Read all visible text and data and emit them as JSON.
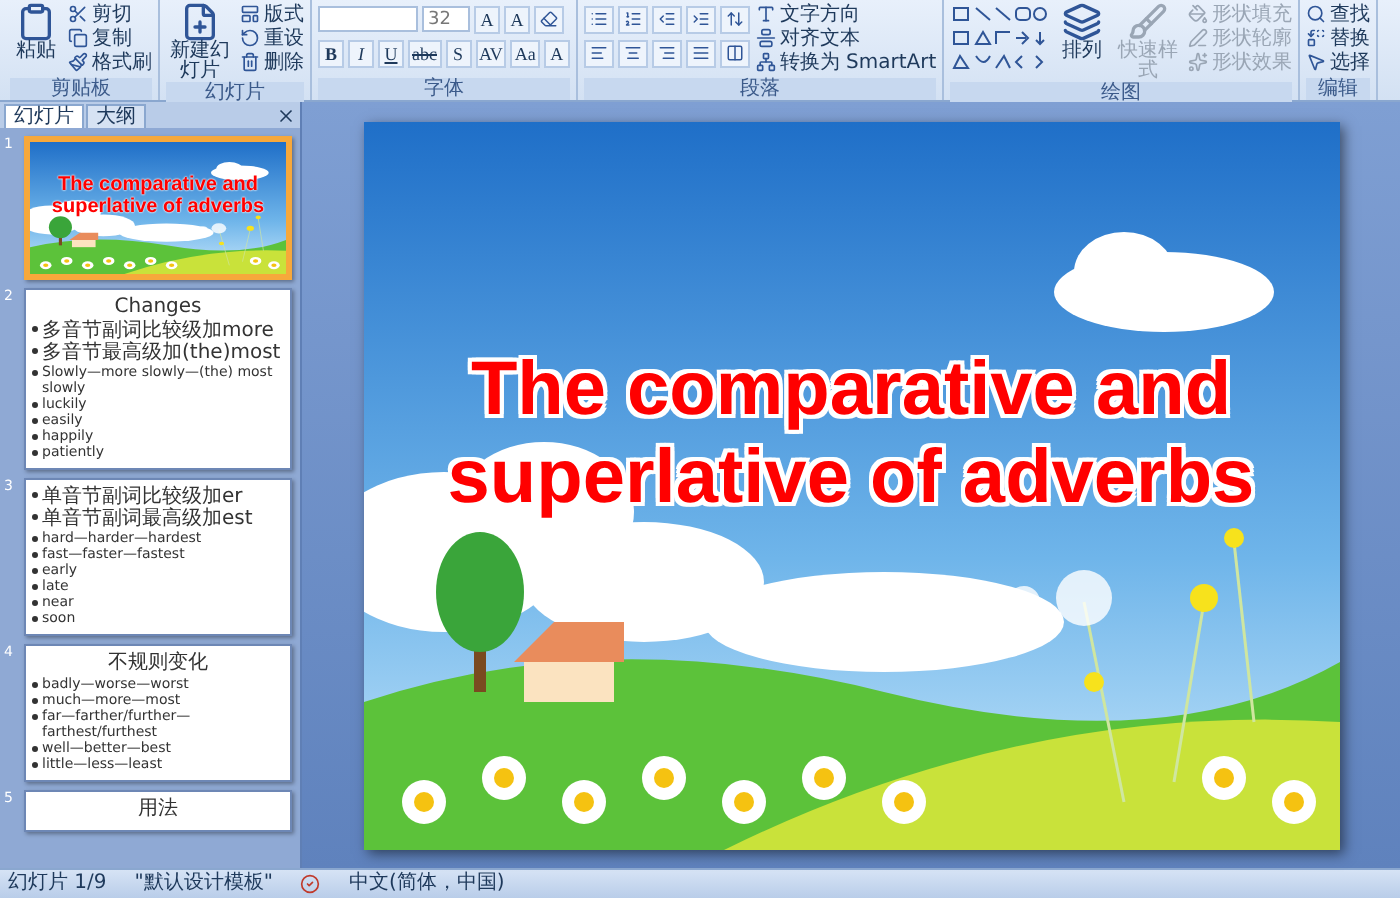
{
  "ribbon": {
    "groups": [
      {
        "label": "剪贴板",
        "parts": [
          {
            "kind": "large",
            "label": "粘贴",
            "disabled": false
          },
          {
            "kind": "column",
            "items": [
              {
                "kind": "small",
                "label": "剪切",
                "disabled": false
              },
              {
                "kind": "small",
                "label": "复制",
                "disabled": false
              },
              {
                "kind": "small",
                "label": "格式刷",
                "disabled": false
              }
            ]
          }
        ]
      },
      {
        "label": "幻灯片",
        "parts": [
          {
            "kind": "large",
            "label": "新建幻灯片",
            "disabled": false
          },
          {
            "kind": "column",
            "items": [
              {
                "kind": "small",
                "label": "版式",
                "disabled": false
              },
              {
                "kind": "small",
                "label": "重设",
                "disabled": false
              },
              {
                "kind": "small",
                "label": "删除",
                "disabled": false
              }
            ]
          }
        ]
      },
      {
        "label": "字体",
        "parts": [
          {
            "kind": "toolrows",
            "rows": [
              {
                "items": [
                  {
                    "kind": "field"
                  },
                  {
                    "kind": "field",
                    "value": "32"
                  },
                  {
                    "kind": "glyph",
                    "label": "A"
                  },
                  {
                    "kind": "glyph",
                    "label": "A"
                  },
                  {
                    "kind": "tool"
                  }
                ]
              },
              {
                "items": [
                  {
                    "kind": "glyph",
                    "label": "B"
                  },
                  {
                    "kind": "glyph",
                    "label": "I"
                  },
                  {
                    "kind": "glyph",
                    "label": "U"
                  },
                  {
                    "kind": "glyph",
                    "label": "abc"
                  },
                  {
                    "kind": "glyph",
                    "label": "S"
                  },
                  {
                    "kind": "glyph",
                    "label": "AV"
                  },
                  {
                    "kind": "glyph",
                    "label": "Aa"
                  },
                  {
                    "kind": "glyph",
                    "label": "A"
                  }
                ]
              }
            ]
          }
        ]
      },
      {
        "label": "段落",
        "parts": [
          {
            "kind": "toolrows",
            "rows": [
              {
                "items": [
                  {
                    "kind": "tool"
                  },
                  {
                    "kind": "tool"
                  },
                  {
                    "kind": "tool"
                  },
                  {
                    "kind": "tool"
                  },
                  {
                    "kind": "tool"
                  }
                ]
              },
              {
                "items": [
                  {
                    "kind": "tool"
                  },
                  {
                    "kind": "tool"
                  },
                  {
                    "kind": "tool"
                  },
                  {
                    "kind": "tool"
                  },
                  {
                    "kind": "tool"
                  }
                ]
              }
            ]
          },
          {
            "kind": "column",
            "items": [
              {
                "kind": "small",
                "label": "文字方向",
                "disabled": false
              },
              {
                "kind": "small",
                "label": "对齐文本",
                "disabled": false
              },
              {
                "kind": "small",
                "label": "转换为 SmartArt",
                "disabled": false
              }
            ]
          }
        ]
      },
      {
        "label": "绘图",
        "parts": [
          {
            "kind": "shapes"
          },
          {
            "kind": "large",
            "label": "排列",
            "disabled": false
          },
          {
            "kind": "large",
            "label": "快速样式",
            "disabled": true
          },
          {
            "kind": "column",
            "items": [
              {
                "kind": "small",
                "label": "形状填充",
                "disabled": true
              },
              {
                "kind": "small",
                "label": "形状轮廓",
                "disabled": true
              },
              {
                "kind": "small",
                "label": "形状效果",
                "disabled": true
              }
            ]
          }
        ]
      },
      {
        "label": "编辑",
        "parts": [
          {
            "kind": "column",
            "items": [
              {
                "kind": "small",
                "label": "查找",
                "disabled": false
              },
              {
                "kind": "small",
                "label": "替换",
                "disabled": false
              },
              {
                "kind": "small",
                "label": "选择",
                "disabled": false
              }
            ]
          }
        ]
      }
    ]
  },
  "panel": {
    "tabs": [
      {
        "label": "幻灯片",
        "selected": true
      },
      {
        "label": "大纲",
        "selected": false
      }
    ],
    "slides": [
      {
        "number": "1",
        "selected": true,
        "kind": "cover",
        "title": "The comparative and superlative of adverbs"
      },
      {
        "number": "2",
        "selected": false,
        "kind": "content",
        "title": "Changes",
        "bullets": [
          "多音节副词比较级加more",
          "多音节最高级加(the)most",
          "Slowly—more slowly—(the) most slowly",
          "luckily",
          "easily",
          "happily",
          "patiently"
        ]
      },
      {
        "number": "3",
        "selected": false,
        "kind": "content",
        "bullets": [
          "单音节副词比较级加er",
          "单音节副词最高级加est",
          "hard—harder—hardest",
          "fast—faster—fastest",
          "early",
          "late",
          "near",
          "soon"
        ]
      },
      {
        "number": "4",
        "selected": false,
        "kind": "content",
        "title": "不规则变化",
        "bullets": [
          "badly—worse—worst",
          "much—more—most",
          "far—farther/further—farthest/furthest",
          "well—better—best",
          "little—less—least"
        ]
      },
      {
        "number": "5",
        "selected": false,
        "kind": "content",
        "title": "用法"
      }
    ]
  },
  "slide": {
    "title": "The comparative and superlative of adverbs"
  },
  "status_bar": {
    "slide": "幻灯片 1/9",
    "theme": "\"默认设计模板\"",
    "language": "中文(简体，中国)"
  }
}
